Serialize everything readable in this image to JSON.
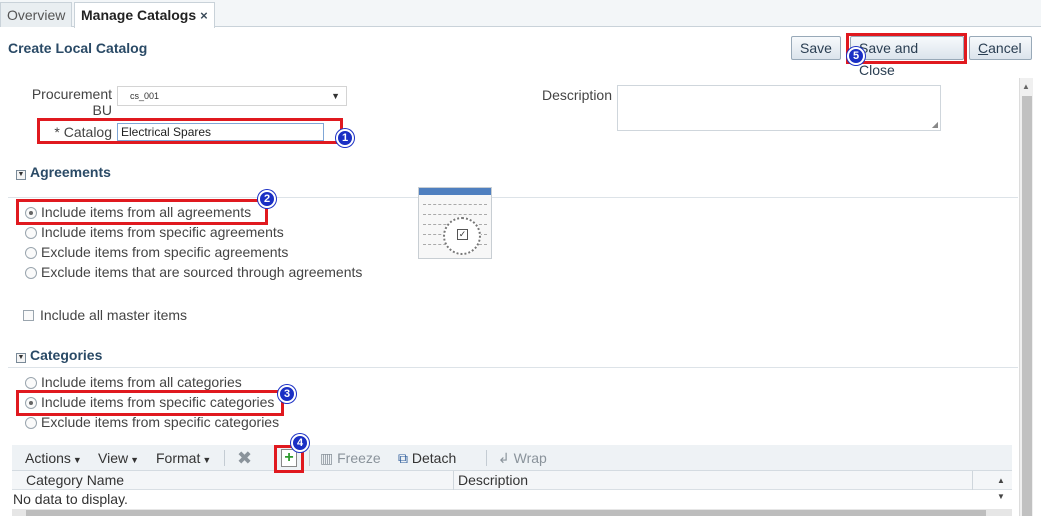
{
  "tabs": [
    {
      "label": "Overview",
      "active": false
    },
    {
      "label": "Manage Catalogs",
      "active": true,
      "close_glyph": "×"
    }
  ],
  "page_title": "Create Local Catalog",
  "buttons": {
    "save": "Save",
    "save_and_close": "Save and Close",
    "cancel_first": "C",
    "cancel_rest": "ancel"
  },
  "form": {
    "procurement_bu_label_line1": "Procurement",
    "procurement_bu_label_line2": "BU",
    "procurement_bu_value": "cs_001",
    "catalog_label": "* Catalog",
    "catalog_value": "Electrical Spares",
    "description_label": "Description",
    "description_value": ""
  },
  "agreements": {
    "title": "Agreements",
    "options": [
      {
        "label": "Include items from all agreements",
        "checked": true
      },
      {
        "label": "Include items from specific agreements",
        "checked": false
      },
      {
        "label": "Exclude items from specific agreements",
        "checked": false
      },
      {
        "label": "Exclude items that are sourced through agreements",
        "checked": false
      }
    ],
    "master_items_label": "Include all master items"
  },
  "categories": {
    "title": "Categories",
    "options": [
      {
        "label": "Include items from all categories",
        "checked": false
      },
      {
        "label": "Include items from specific categories",
        "checked": true
      },
      {
        "label": "Exclude items from specific categories",
        "checked": false
      }
    ]
  },
  "table_toolbar": {
    "actions": "Actions",
    "view": "View",
    "format": "Format",
    "freeze": "Freeze",
    "detach": "Detach",
    "wrap": "Wrap"
  },
  "table": {
    "columns": [
      "Category Name",
      "Description"
    ],
    "empty_text": "No data to display."
  },
  "callouts": [
    "1",
    "2",
    "3",
    "4",
    "5"
  ],
  "icons": {
    "delete": "delete-x-icon",
    "add": "add-row-icon",
    "freeze": "freeze-columns-icon",
    "detach": "detach-table-icon",
    "wrap": "wrap-text-icon"
  },
  "colors": {
    "callout_border": "#e0191f",
    "badge": "#1a2fc4",
    "heading": "#2a4a66"
  }
}
